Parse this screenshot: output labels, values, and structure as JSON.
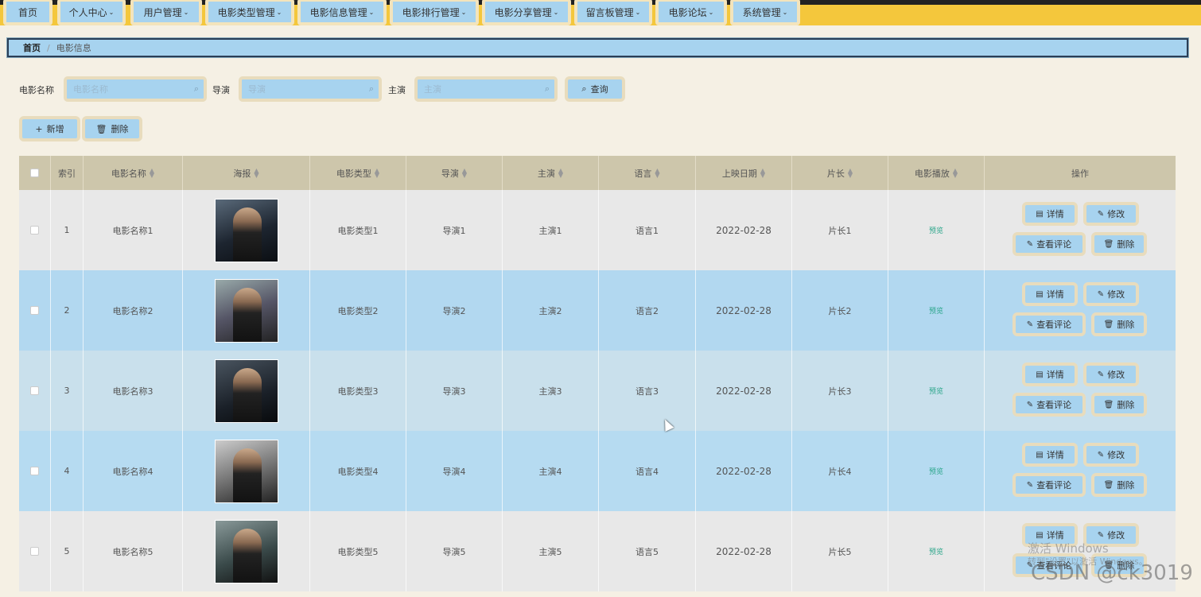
{
  "nav": [
    {
      "label": "首页",
      "has_menu": false
    },
    {
      "label": "个人中心",
      "has_menu": true
    },
    {
      "label": "用户管理",
      "has_menu": true
    },
    {
      "label": "电影类型管理",
      "has_menu": true
    },
    {
      "label": "电影信息管理",
      "has_menu": true
    },
    {
      "label": "电影排行管理",
      "has_menu": true
    },
    {
      "label": "电影分享管理",
      "has_menu": true
    },
    {
      "label": "留言板管理",
      "has_menu": true
    },
    {
      "label": "电影论坛",
      "has_menu": true
    },
    {
      "label": "系统管理",
      "has_menu": true
    }
  ],
  "breadcrumb": {
    "home": "首页",
    "separator": "/",
    "current": "电影信息"
  },
  "search": {
    "name_label": "电影名称",
    "name_placeholder": "电影名称",
    "director_label": "导演",
    "director_placeholder": "导演",
    "actor_label": "主演",
    "actor_placeholder": "主演",
    "query_button": "查询"
  },
  "toolbar": {
    "add_button": "新增",
    "delete_button": "删除"
  },
  "table": {
    "headers": {
      "index": "索引",
      "name": "电影名称",
      "poster": "海报",
      "type": "电影类型",
      "director": "导演",
      "actor": "主演",
      "language": "语言",
      "release_date": "上映日期",
      "duration": "片长",
      "play": "电影播放",
      "actions": "操作"
    },
    "rows": [
      {
        "index": "1",
        "name": "电影名称1",
        "type": "电影类型1",
        "director": "导演1",
        "actor": "主演1",
        "language": "语言1",
        "release_date": "2022-02-28",
        "duration": "片长1",
        "play": "预览"
      },
      {
        "index": "2",
        "name": "电影名称2",
        "type": "电影类型2",
        "director": "导演2",
        "actor": "主演2",
        "language": "语言2",
        "release_date": "2022-02-28",
        "duration": "片长2",
        "play": "预览"
      },
      {
        "index": "3",
        "name": "电影名称3",
        "type": "电影类型3",
        "director": "导演3",
        "actor": "主演3",
        "language": "语言3",
        "release_date": "2022-02-28",
        "duration": "片长3",
        "play": "预览"
      },
      {
        "index": "4",
        "name": "电影名称4",
        "type": "电影类型4",
        "director": "导演4",
        "actor": "主演4",
        "language": "语言4",
        "release_date": "2022-02-28",
        "duration": "片长4",
        "play": "预览"
      },
      {
        "index": "5",
        "name": "电影名称5",
        "type": "电影类型5",
        "director": "导演5",
        "actor": "主演5",
        "language": "语言5",
        "release_date": "2022-02-28",
        "duration": "片长5",
        "play": "预览"
      }
    ],
    "row_actions": {
      "detail": "详情",
      "edit": "修改",
      "comments": "查看评论",
      "delete": "删除"
    }
  },
  "watermark": {
    "line1": "激活 Windows",
    "line2": "转到\"设置\"以激活 Windows。",
    "line3": "CSDN @ck3019"
  },
  "icons": {
    "search": "search-icon",
    "add": "plus-icon",
    "delete": "trash-icon",
    "detail": "document-icon",
    "edit": "pencil-icon",
    "sort": "sort-icon"
  },
  "colors": {
    "nav_bg": "#f4c73c",
    "accent": "#a7d3ef",
    "page_bg": "#f5f0e4",
    "button_border": "#e8dcbd",
    "preview": "#2aa58a"
  }
}
